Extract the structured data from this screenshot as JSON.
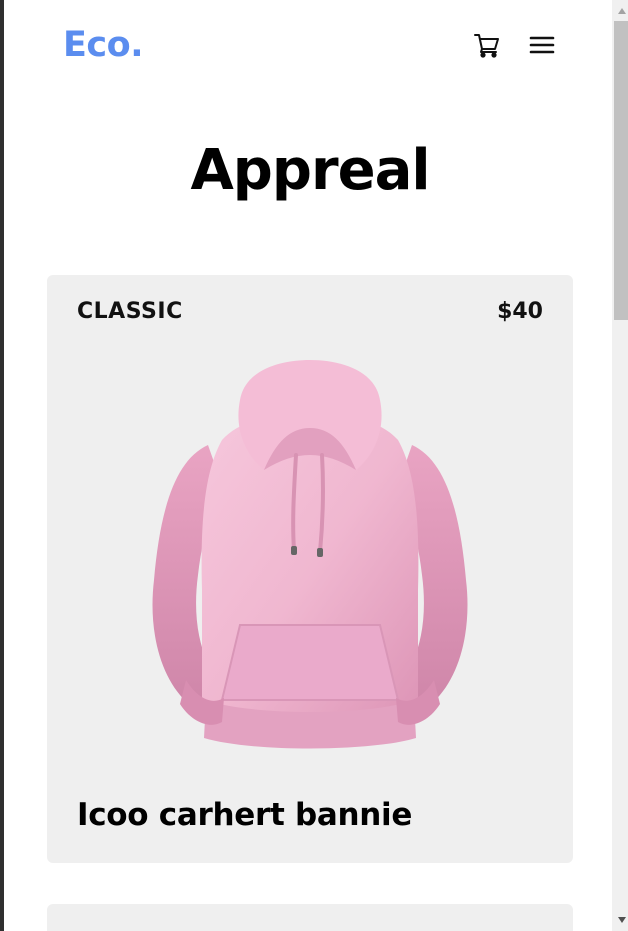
{
  "header": {
    "logo": "Eco.",
    "cart_icon": "cart-icon",
    "menu_icon": "hamburger-menu-icon"
  },
  "page": {
    "title": "Appreal"
  },
  "products": [
    {
      "tag": "CLASSIC",
      "price": "$40",
      "name": "Icoo carhert bannie",
      "image_subject": "pink hoodie",
      "image_color": "#f0b8d2"
    }
  ],
  "colors": {
    "logo": "#5b8def",
    "card_background": "#efefef",
    "text": "#000000"
  }
}
